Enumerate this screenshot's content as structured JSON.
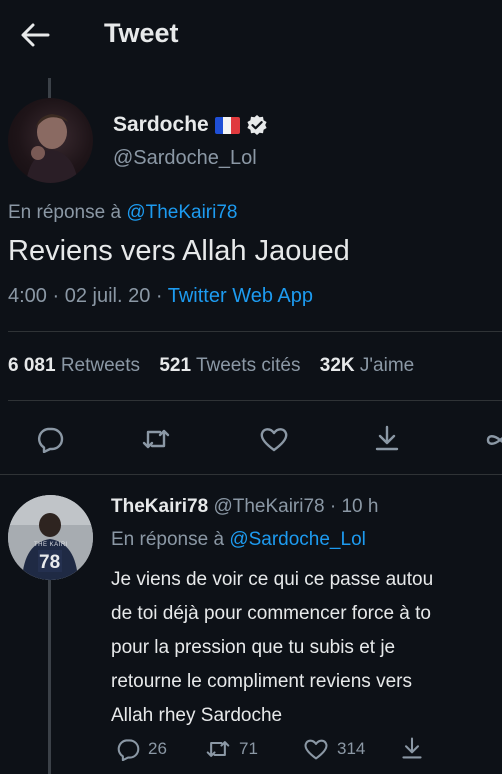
{
  "header": {
    "title": "Tweet"
  },
  "main_tweet": {
    "name": "Sardoche",
    "flag": "🇫🇷",
    "handle": "@Sardoche_Lol",
    "reply_prefix": "En réponse à",
    "reply_to": "@TheKairi78",
    "text": "Reviens vers Allah Jaoued",
    "time": "4:00 · 02 juil. 20 ·",
    "source": "Twitter Web App",
    "stats": {
      "retweets_count": "6 081",
      "retweets_label": "Retweets",
      "quotes_count": "521",
      "quotes_label": "Tweets cités",
      "likes_count": "32K",
      "likes_label": "J'aime"
    }
  },
  "reply_tweet": {
    "name": "TheKairi78",
    "handle_time": "@TheKairi78 · 10 h",
    "reply_prefix": "En réponse à",
    "reply_to": "@Sardoche_Lol",
    "lines": [
      "Je viens de voir ce qui ce passe autou",
      "de toi déjà pour commencer force à to",
      "pour la pression que tu subis et je",
      "retourne le compliment reviens vers",
      "Allah rhey Sardoche"
    ],
    "actions": {
      "replies": "26",
      "retweets": "71",
      "likes": "314"
    },
    "jersey_number": "78",
    "jersey_text": "THE KAIRI"
  },
  "colors": {
    "background": "#0d1117",
    "accent": "#1d9bf0",
    "muted": "#8b98a5"
  }
}
